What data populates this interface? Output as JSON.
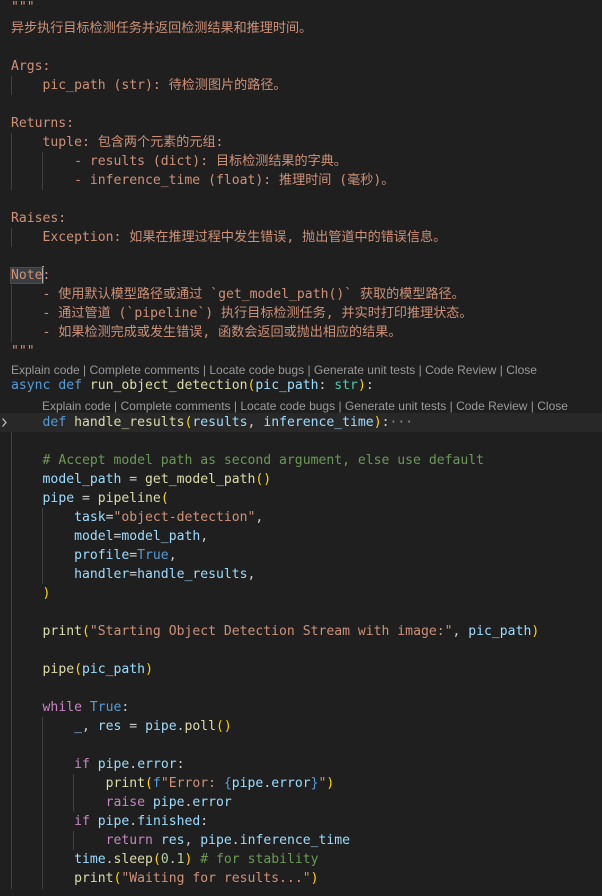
{
  "theme": {
    "background": "#1f1f1f",
    "docstring": "#ce9178",
    "keyword": "#569cd6",
    "control": "#c586c0",
    "function": "#dcdcaa",
    "variable": "#9cdcfe",
    "string": "#ce9178",
    "number": "#b5cea8",
    "comment": "#6a9955",
    "punctuation": "#cccccc",
    "bracket1": "#ffd700",
    "bracket2": "#da70d6",
    "bracket3": "#179fff",
    "type": "#4ec9b0",
    "codelens": "#999999"
  },
  "editor": {
    "codelens_outer": [
      "Explain code",
      "Complete comments",
      "Locate code bugs",
      "Generate unit tests",
      "Code Review",
      "Close"
    ],
    "codelens_inner": [
      "Explain code",
      "Complete comments",
      "Locate code bugs",
      "Generate unit tests",
      "Code Review",
      "Close"
    ],
    "fold_icon": "chevron-right-icon",
    "collapsed_marker": "···",
    "lines": [
      {
        "id": "l1",
        "tokens": [
          [
            "\"\"\"",
            "docstring"
          ]
        ]
      },
      {
        "id": "l2",
        "tokens": [
          [
            "异步执行目标检测任务并返回检测结果和推理时间。",
            "docstring"
          ]
        ]
      },
      {
        "id": "l3",
        "tokens": []
      },
      {
        "id": "l4",
        "tokens": [
          [
            "Args:",
            "docstring"
          ]
        ]
      },
      {
        "id": "l5",
        "tokens": [
          [
            "    pic_path (str): 待检测图片的路径。",
            "docstring"
          ]
        ]
      },
      {
        "id": "l6",
        "tokens": []
      },
      {
        "id": "l7",
        "tokens": [
          [
            "Returns:",
            "docstring"
          ]
        ]
      },
      {
        "id": "l8",
        "tokens": [
          [
            "    tuple: 包含两个元素的元组:",
            "docstring"
          ]
        ]
      },
      {
        "id": "l9",
        "tokens": [
          [
            "        - results (dict): 目标检测结果的字典。",
            "docstring"
          ]
        ]
      },
      {
        "id": "l10",
        "tokens": [
          [
            "        - inference_time (float): 推理时间 (毫秒)。",
            "docstring"
          ]
        ]
      },
      {
        "id": "l11",
        "tokens": []
      },
      {
        "id": "l12",
        "tokens": [
          [
            "Raises:",
            "docstring"
          ]
        ]
      },
      {
        "id": "l13",
        "tokens": [
          [
            "    Exception: 如果在推理过程中发生错误, 抛出管道中的错误信息。",
            "docstring"
          ]
        ]
      },
      {
        "id": "l14",
        "tokens": []
      },
      {
        "id": "l15",
        "tokens": [
          [
            "Note",
            "docstring-highlight"
          ],
          [
            "",
            "cursor"
          ],
          [
            ":",
            "docstring"
          ]
        ]
      },
      {
        "id": "l16",
        "tokens": [
          [
            "    - 使用默认模型路径或通过 `get_model_path()` 获取的模型路径。",
            "docstring"
          ]
        ]
      },
      {
        "id": "l17",
        "tokens": [
          [
            "    - 通过管道 (`pipeline`) 执行目标检测任务, 并实时打印推理状态。",
            "docstring"
          ]
        ]
      },
      {
        "id": "l18",
        "tokens": [
          [
            "    - 如果检测完成或发生错误, 函数会返回或抛出相应的结果。",
            "docstring"
          ]
        ]
      },
      {
        "id": "l19",
        "tokens": [
          [
            "\"\"\"",
            "docstring"
          ]
        ]
      },
      {
        "id": "l20",
        "tokens": [
          [
            "async",
            "keyword"
          ],
          [
            " ",
            "punctuation"
          ],
          [
            "def",
            "keyword"
          ],
          [
            " ",
            "punctuation"
          ],
          [
            "run_object_detection",
            "function"
          ],
          [
            "(",
            "bracket1"
          ],
          [
            "pic_path",
            "variable"
          ],
          [
            ": ",
            "punctuation"
          ],
          [
            "str",
            "type"
          ],
          [
            ")",
            "bracket1"
          ],
          [
            ":",
            "punctuation"
          ]
        ]
      },
      {
        "id": "l21",
        "tokens": [
          [
            "    ",
            "punctuation"
          ],
          [
            "def",
            "keyword"
          ],
          [
            " ",
            "punctuation"
          ],
          [
            "handle_results",
            "function"
          ],
          [
            "(",
            "bracket1"
          ],
          [
            "results",
            "variable"
          ],
          [
            ", ",
            "punctuation"
          ],
          [
            "inference_time",
            "variable"
          ],
          [
            ")",
            "bracket1"
          ],
          [
            ":",
            "punctuation"
          ],
          [
            "···",
            "ellipsis"
          ]
        ]
      },
      {
        "id": "l22",
        "tokens": []
      },
      {
        "id": "l23",
        "tokens": [
          [
            "    ",
            "punctuation"
          ],
          [
            "# Accept model path as second argument, else use default",
            "comment"
          ]
        ]
      },
      {
        "id": "l24",
        "tokens": [
          [
            "    ",
            "punctuation"
          ],
          [
            "model_path",
            "variable"
          ],
          [
            " = ",
            "punctuation"
          ],
          [
            "get_model_path",
            "function"
          ],
          [
            "()",
            "bracket1"
          ]
        ]
      },
      {
        "id": "l25",
        "tokens": [
          [
            "    ",
            "punctuation"
          ],
          [
            "pipe",
            "variable"
          ],
          [
            " = ",
            "punctuation"
          ],
          [
            "pipeline",
            "function"
          ],
          [
            "(",
            "bracket1"
          ]
        ]
      },
      {
        "id": "l26",
        "tokens": [
          [
            "        ",
            "punctuation"
          ],
          [
            "task",
            "variable"
          ],
          [
            "=",
            "punctuation"
          ],
          [
            "\"object-detection\"",
            "string"
          ],
          [
            ",",
            "punctuation"
          ]
        ]
      },
      {
        "id": "l27",
        "tokens": [
          [
            "        ",
            "punctuation"
          ],
          [
            "model",
            "variable"
          ],
          [
            "=",
            "punctuation"
          ],
          [
            "model_path",
            "variable"
          ],
          [
            ",",
            "punctuation"
          ]
        ]
      },
      {
        "id": "l28",
        "tokens": [
          [
            "        ",
            "punctuation"
          ],
          [
            "profile",
            "variable"
          ],
          [
            "=",
            "punctuation"
          ],
          [
            "True",
            "keyword"
          ],
          [
            ",",
            "punctuation"
          ]
        ]
      },
      {
        "id": "l29",
        "tokens": [
          [
            "        ",
            "punctuation"
          ],
          [
            "handler",
            "variable"
          ],
          [
            "=",
            "punctuation"
          ],
          [
            "handle_results",
            "variable"
          ],
          [
            ",",
            "punctuation"
          ]
        ]
      },
      {
        "id": "l30",
        "tokens": [
          [
            "    ",
            "punctuation"
          ],
          [
            ")",
            "bracket1"
          ]
        ]
      },
      {
        "id": "l31",
        "tokens": []
      },
      {
        "id": "l32",
        "tokens": [
          [
            "    ",
            "punctuation"
          ],
          [
            "print",
            "function"
          ],
          [
            "(",
            "bracket1"
          ],
          [
            "\"Starting Object Detection Stream with image:\"",
            "string"
          ],
          [
            ", ",
            "punctuation"
          ],
          [
            "pic_path",
            "variable"
          ],
          [
            ")",
            "bracket1"
          ]
        ]
      },
      {
        "id": "l33",
        "tokens": []
      },
      {
        "id": "l34",
        "tokens": [
          [
            "    ",
            "punctuation"
          ],
          [
            "pipe",
            "function"
          ],
          [
            "(",
            "bracket1"
          ],
          [
            "pic_path",
            "variable"
          ],
          [
            ")",
            "bracket1"
          ]
        ]
      },
      {
        "id": "l35",
        "tokens": []
      },
      {
        "id": "l36",
        "tokens": [
          [
            "    ",
            "punctuation"
          ],
          [
            "while",
            "control"
          ],
          [
            " ",
            "punctuation"
          ],
          [
            "True",
            "keyword"
          ],
          [
            ":",
            "punctuation"
          ]
        ]
      },
      {
        "id": "l37",
        "tokens": [
          [
            "        ",
            "punctuation"
          ],
          [
            "_",
            "variable"
          ],
          [
            ", ",
            "punctuation"
          ],
          [
            "res",
            "variable"
          ],
          [
            " = ",
            "punctuation"
          ],
          [
            "pipe",
            "variable"
          ],
          [
            ".",
            "punctuation"
          ],
          [
            "poll",
            "function"
          ],
          [
            "()",
            "bracket1"
          ]
        ]
      },
      {
        "id": "l38",
        "tokens": []
      },
      {
        "id": "l39",
        "tokens": [
          [
            "        ",
            "punctuation"
          ],
          [
            "if",
            "control"
          ],
          [
            " ",
            "punctuation"
          ],
          [
            "pipe",
            "variable"
          ],
          [
            ".",
            "punctuation"
          ],
          [
            "error",
            "variable"
          ],
          [
            ":",
            "punctuation"
          ]
        ]
      },
      {
        "id": "l40",
        "tokens": [
          [
            "            ",
            "punctuation"
          ],
          [
            "print",
            "function"
          ],
          [
            "(",
            "bracket1"
          ],
          [
            "f",
            "keyword"
          ],
          [
            "\"Error: ",
            "string"
          ],
          [
            "{",
            "keyword"
          ],
          [
            "pipe",
            "variable"
          ],
          [
            ".",
            "punctuation"
          ],
          [
            "error",
            "variable"
          ],
          [
            "}",
            "keyword"
          ],
          [
            "\"",
            "string"
          ],
          [
            ")",
            "bracket1"
          ]
        ]
      },
      {
        "id": "l41",
        "tokens": [
          [
            "            ",
            "punctuation"
          ],
          [
            "raise",
            "control"
          ],
          [
            " ",
            "punctuation"
          ],
          [
            "pipe",
            "variable"
          ],
          [
            ".",
            "punctuation"
          ],
          [
            "error",
            "variable"
          ]
        ]
      },
      {
        "id": "l42",
        "tokens": [
          [
            "        ",
            "punctuation"
          ],
          [
            "if",
            "control"
          ],
          [
            " ",
            "punctuation"
          ],
          [
            "pipe",
            "variable"
          ],
          [
            ".",
            "punctuation"
          ],
          [
            "finished",
            "variable"
          ],
          [
            ":",
            "punctuation"
          ]
        ]
      },
      {
        "id": "l43",
        "tokens": [
          [
            "            ",
            "punctuation"
          ],
          [
            "return",
            "control"
          ],
          [
            " ",
            "punctuation"
          ],
          [
            "res",
            "variable"
          ],
          [
            ", ",
            "punctuation"
          ],
          [
            "pipe",
            "variable"
          ],
          [
            ".",
            "punctuation"
          ],
          [
            "inference_time",
            "variable"
          ]
        ]
      },
      {
        "id": "l44",
        "tokens": [
          [
            "        ",
            "punctuation"
          ],
          [
            "time",
            "variable"
          ],
          [
            ".",
            "punctuation"
          ],
          [
            "sleep",
            "function"
          ],
          [
            "(",
            "bracket1"
          ],
          [
            "0.1",
            "number"
          ],
          [
            ")",
            "bracket1"
          ],
          [
            " ",
            "punctuation"
          ],
          [
            "# for stability",
            "comment"
          ]
        ]
      },
      {
        "id": "l45",
        "tokens": [
          [
            "        ",
            "punctuation"
          ],
          [
            "print",
            "function"
          ],
          [
            "(",
            "bracket1"
          ],
          [
            "\"Waiting for results...\"",
            "string"
          ],
          [
            ")",
            "bracket1"
          ]
        ]
      }
    ]
  }
}
